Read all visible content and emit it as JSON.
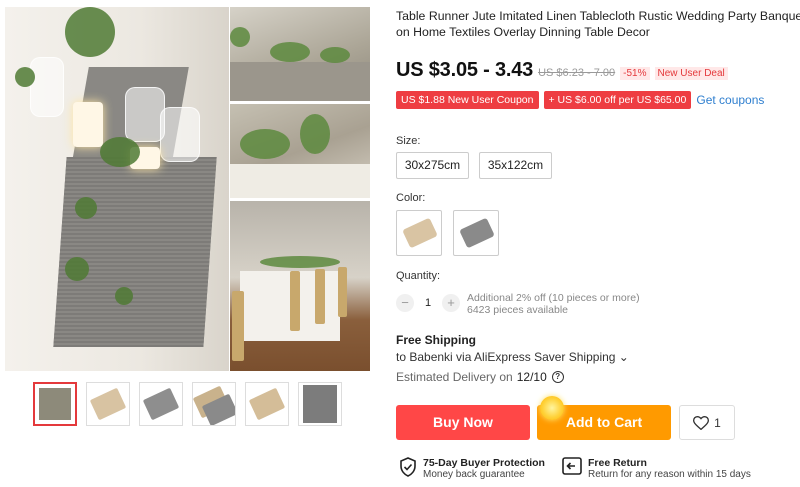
{
  "product": {
    "title_line1": "Table Runner Jute Imitated Linen Tablecloth Rustic Wedding Party Banquet D",
    "title_line2": "on Home Textiles Overlay Dinning Table Decor"
  },
  "price": {
    "current": "US $3.05 - 3.43",
    "original": "US $6.23 - 7.00",
    "discount": "-51%",
    "deal_label": "New User Deal"
  },
  "coupons": {
    "items": [
      "US $1.88 New User Coupon",
      "+ US $6.00 off per US $65.00"
    ],
    "get_label": "Get coupons"
  },
  "size": {
    "label": "Size:",
    "options": [
      "30x275cm",
      "35x122cm"
    ]
  },
  "color": {
    "label": "Color:",
    "options": [
      {
        "name": "beige",
        "swatch": "#d9c4a3"
      },
      {
        "name": "gray",
        "swatch": "#8a8a8a"
      }
    ]
  },
  "quantity": {
    "label": "Quantity:",
    "value": "1",
    "minus": "−",
    "plus": "+",
    "note_line1": "Additional 2% off (10 pieces or more)",
    "note_line2": "6423 pieces available"
  },
  "shipping": {
    "title": "Free Shipping",
    "line": "to Babenki via AliExpress Saver Shipping ⌄",
    "delivery_label": "Estimated Delivery on",
    "delivery_date": "12/10",
    "help_icon": "?"
  },
  "actions": {
    "buy_now": "Buy Now",
    "add_to_cart": "Add to Cart",
    "wishlist_count": "1"
  },
  "guarantees": [
    {
      "title": "75-Day Buyer Protection",
      "subtitle": "Money back guarantee",
      "icon": "shield-check-icon"
    },
    {
      "title": "Free Return",
      "subtitle": "Return for any reason within 15 days",
      "icon": "return-icon"
    }
  ],
  "gallery": {
    "thumbnails": [
      {
        "name": "wedding-table",
        "color": "#8d8a7a"
      },
      {
        "name": "beige-roll",
        "color": "#d8c3a2"
      },
      {
        "name": "gray-roll",
        "color": "#8e8e8e"
      },
      {
        "name": "both-rolls",
        "color": "#a69a85"
      },
      {
        "name": "beige-roll-2",
        "color": "#d4bd98"
      },
      {
        "name": "gray-flat",
        "color": "#7c7c7c"
      }
    ]
  },
  "colors": {
    "accent_red": "#ff4747",
    "accent_orange": "#ff9a00",
    "coupon_red": "#ee3d42",
    "link_blue": "#2f7fcf"
  }
}
